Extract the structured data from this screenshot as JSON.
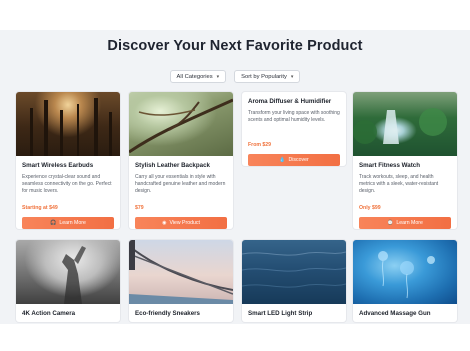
{
  "page": {
    "title": "Discover Your Next Favorite Product"
  },
  "filters": {
    "category": "All Categories",
    "sort": "Sort by Popularity"
  },
  "products": [
    {
      "name": "Smart Wireless Earbuds",
      "description": "Experience crystal-clear sound and seamless connectivity on the go. Perfect for music lovers.",
      "price": "Starting at $49",
      "button": "Learn More",
      "button_icon": "headphones-icon"
    },
    {
      "name": "Stylish Leather Backpack",
      "description": "Carry all your essentials in style with handcrafted genuine leather and modern design.",
      "price": "$79",
      "button": "View Product",
      "button_icon": "eye-icon"
    },
    {
      "name": "Aroma Diffuser & Humidifier",
      "description": "Transform your living space with soothing scents and optimal humidity levels.",
      "price": "From $29",
      "button": "Discover",
      "button_icon": "drop-icon"
    },
    {
      "name": "Smart Fitness Watch",
      "description": "Track workouts, sleep, and health metrics with a sleek, water-resistant design.",
      "price": "Only $99",
      "button": "Learn More",
      "button_icon": "watch-icon"
    },
    {
      "name": "4K Action Camera"
    },
    {
      "name": "Eco-friendly Sneakers"
    },
    {
      "name": "Smart LED Light Strip"
    },
    {
      "name": "Advanced Massage Gun"
    }
  ],
  "colors": {
    "accent": "#f26f43",
    "background": "#f1f3f6"
  }
}
